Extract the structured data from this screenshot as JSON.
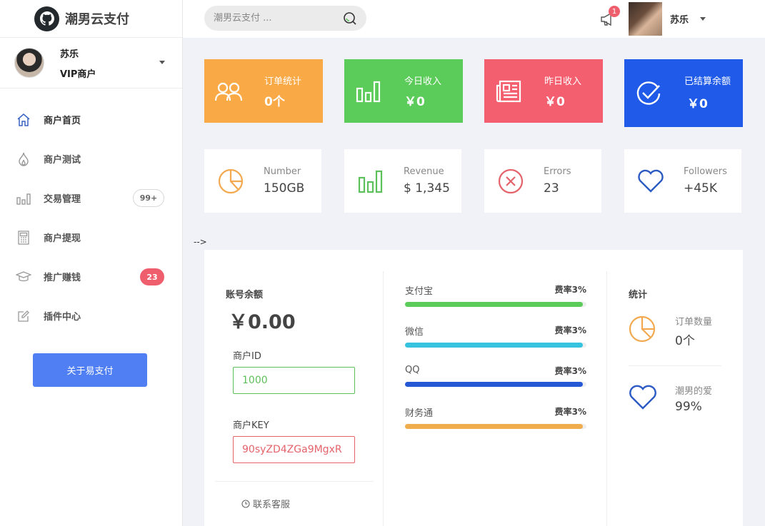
{
  "brand": {
    "title": "潮男云支付"
  },
  "sidebar": {
    "user": {
      "name": "苏乐",
      "role": "VIP商户"
    },
    "items": [
      {
        "label": "商户首页",
        "icon": "home-icon"
      },
      {
        "label": "商户测试",
        "icon": "flame-icon"
      },
      {
        "label": "交易管理",
        "icon": "bar-chart-icon",
        "badge": "99+"
      },
      {
        "label": "商户提现",
        "icon": "calculator-icon"
      },
      {
        "label": "推广赚钱",
        "icon": "graduation-cap-icon",
        "badge": "23"
      },
      {
        "label": "插件中心",
        "icon": "edit-icon"
      }
    ],
    "about_button": "关于易支付"
  },
  "header": {
    "search_placeholder": "潮男云支付 ...",
    "notification_count": "1",
    "user_name": "苏乐"
  },
  "color_cards": [
    {
      "title": "订单统计",
      "value": "0个",
      "icon": "users-icon",
      "color": "#f9aa47"
    },
    {
      "title": "今日收入",
      "value": "￥0",
      "icon": "bar-chart-icon",
      "color": "#5bcb5a"
    },
    {
      "title": "昨日收入",
      "value": "￥0",
      "icon": "newspaper-icon",
      "color": "#f45f6f"
    },
    {
      "title": "已结算余额",
      "value": "￥0",
      "icon": "check-circle-icon",
      "color": "#1f5be8"
    }
  ],
  "white_cards": [
    {
      "title": "Number",
      "value": "150GB",
      "icon": "pie-chart-icon",
      "color": "#f3a94f"
    },
    {
      "title": "Revenue",
      "value": "$ 1,345",
      "icon": "bar-chart-icon",
      "color": "#5cc15a"
    },
    {
      "title": "Errors",
      "value": "23",
      "icon": "x-circle-icon",
      "color": "#e5636b"
    },
    {
      "title": "Followers",
      "value": "+45K",
      "icon": "heart-icon",
      "color": "#2d5bc4"
    }
  ],
  "stray_text": "-->",
  "account": {
    "title": "账号余额",
    "balance": "￥0.00",
    "id_label": "商户ID",
    "id_value": "1000",
    "key_label": "商户KEY",
    "key_value": "90syZD4ZGa9MgxR",
    "contact": "联系客服"
  },
  "rates": [
    {
      "name": "支付宝",
      "rate": "费率3%",
      "fill": 0.98,
      "color": "#5bcb5a"
    },
    {
      "name": "微信",
      "rate": "费率3%",
      "fill": 0.98,
      "color": "#36c3e0"
    },
    {
      "name": "QQ",
      "rate": "费率3%",
      "fill": 0.98,
      "color": "#2458d4"
    },
    {
      "name": "财务通",
      "rate": "费率3%",
      "fill": 0.98,
      "color": "#f0ad4e"
    }
  ],
  "stats": {
    "title": "统计",
    "items": [
      {
        "title": "订单数量",
        "value": "0个",
        "icon": "pie-chart-icon"
      },
      {
        "title": "潮男的爱",
        "value": "99%",
        "icon": "heart-icon"
      }
    ]
  }
}
